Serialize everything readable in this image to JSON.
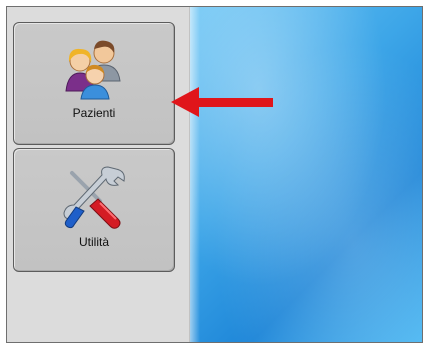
{
  "nav": {
    "items": [
      {
        "label": "Pazienti",
        "icon": "patients-icon"
      },
      {
        "label": "Utilità",
        "icon": "tools-icon"
      }
    ]
  },
  "annotation": {
    "arrow_color": "#e0151a",
    "icon": "red-arrow-left-icon"
  },
  "colors": {
    "sidebar": "#dcdcdc",
    "button": "#c6c6c6",
    "desktop": "#3da6e8"
  }
}
